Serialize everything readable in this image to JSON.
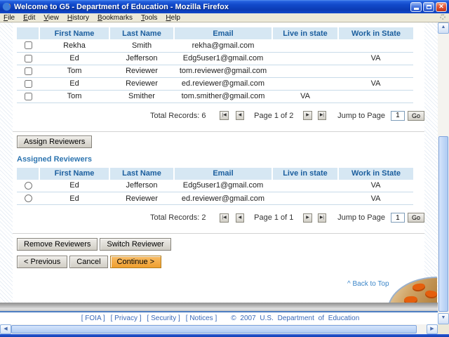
{
  "window": {
    "title": "Welcome to G5 - Department of Education - Mozilla Firefox",
    "menu": [
      "File",
      "Edit",
      "View",
      "History",
      "Bookmarks",
      "Tools",
      "Help"
    ]
  },
  "icons": {
    "close": "✕",
    "first_page": "|◀",
    "prev_page": "◀",
    "next_page": "▶",
    "last_page": "▶|",
    "up_arrow": "▲",
    "down_arrow": "▼",
    "left_arrow": "◀",
    "right_arrow": "▶"
  },
  "colors": {
    "titlebar_blue": "#1149ca",
    "table_header_bg": "#d6e7f3",
    "table_header_text": "#1b5e9e",
    "heading_blue": "#2e75b0",
    "continue_orange": "#f2a93b",
    "link_blue": "#3868b8"
  },
  "available_reviewers": {
    "selector": "checkbox",
    "columns": [
      "",
      "First Name",
      "Last Name",
      "Email",
      "Live in state",
      "Work in State"
    ],
    "rows": [
      [
        "Rekha",
        "Smith",
        "rekha@gmail.com",
        "",
        ""
      ],
      [
        "Ed",
        "Jefferson",
        "Edg5user1@gmail.com",
        "",
        "VA"
      ],
      [
        "Tom",
        "Reviewer",
        "tom.reviewer@gmail.com",
        "",
        ""
      ],
      [
        "Ed",
        "Reviewer",
        "ed.reviewer@gmail.com",
        "",
        "VA"
      ],
      [
        "Tom",
        "Smither",
        "tom.smither@gmail.com",
        "VA",
        ""
      ]
    ],
    "pagination": {
      "total": "Total Records: 6",
      "page": "Page 1 of 2",
      "jump_label": "Jump to Page",
      "jump_value": "1",
      "go": "Go"
    }
  },
  "assign_button": "Assign Reviewers",
  "assigned_reviewers": {
    "selector": "radio",
    "heading": "Assigned Reviewers",
    "columns": [
      "",
      "First Name",
      "Last Name",
      "Email",
      "Live in state",
      "Work in State"
    ],
    "rows": [
      [
        "Ed",
        "Jefferson",
        "Edg5user1@gmail.com",
        "",
        "VA"
      ],
      [
        "Ed",
        "Reviewer",
        "ed.reviewer@gmail.com",
        "",
        "VA"
      ]
    ],
    "pagination": {
      "total": "Total Records: 2",
      "page": "Page 1 of 1",
      "jump_label": "Jump to Page",
      "jump_value": "1",
      "go": "Go"
    }
  },
  "actions": {
    "remove": "Remove Reviewers",
    "switch": "Switch Reviewer",
    "previous": "< Previous",
    "cancel": "Cancel",
    "continue": "Continue >"
  },
  "back_to_top": "^ Back to Top",
  "footer": {
    "links": [
      "[ FOIA ]",
      "[ Privacy ]",
      "[ Security ]",
      "[ Notices ]"
    ],
    "copyright": "© 2007 U.S. Department of Education"
  }
}
